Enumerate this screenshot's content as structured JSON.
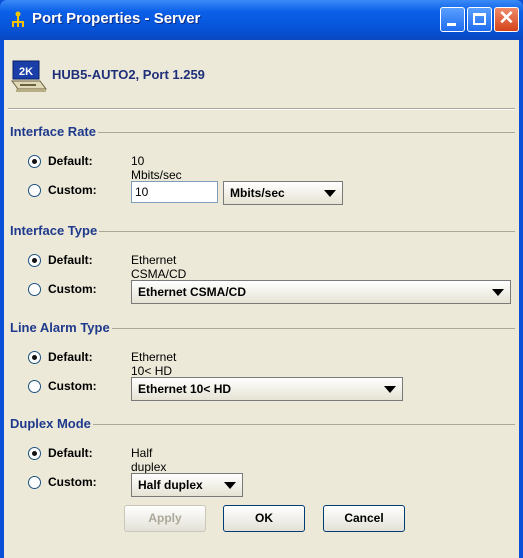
{
  "window": {
    "title": "Port Properties - Server"
  },
  "header": {
    "device": "HUB5-AUTO2, Port 1.259",
    "icon_badge": "2K"
  },
  "groups": {
    "interface_rate": {
      "title": "Interface Rate",
      "default_label": "Default:",
      "default_value": "10 Mbits/sec",
      "custom_label": "Custom:",
      "custom_value": "10",
      "unit": "Mbits/sec",
      "selected": "default"
    },
    "interface_type": {
      "title": "Interface Type",
      "default_label": "Default:",
      "default_value": "Ethernet CSMA/CD",
      "custom_label": "Custom:",
      "custom_value": "Ethernet CSMA/CD",
      "selected": "default"
    },
    "line_alarm_type": {
      "title": "Line Alarm Type",
      "default_label": "Default:",
      "default_value": "Ethernet 10< HD",
      "custom_label": "Custom:",
      "custom_value": "Ethernet 10< HD",
      "selected": "default"
    },
    "duplex_mode": {
      "title": "Duplex Mode",
      "default_label": "Default:",
      "default_value": "Half duplex",
      "custom_label": "Custom:",
      "custom_value": "Half duplex",
      "selected": "default"
    }
  },
  "buttons": {
    "apply": "Apply",
    "ok": "OK",
    "cancel": "Cancel",
    "apply_enabled": false
  },
  "icons": {
    "title": "network-icon",
    "header": "hub-device-icon",
    "minimize": "minimize-icon",
    "maximize": "maximize-icon",
    "close": "close-icon",
    "dropdown": "chevron-down-icon"
  },
  "colors": {
    "titlebar": "#0654d8",
    "client_bg": "#ece9d8",
    "group_title": "#1f3a8c",
    "header_text": "#1f2f7a"
  }
}
